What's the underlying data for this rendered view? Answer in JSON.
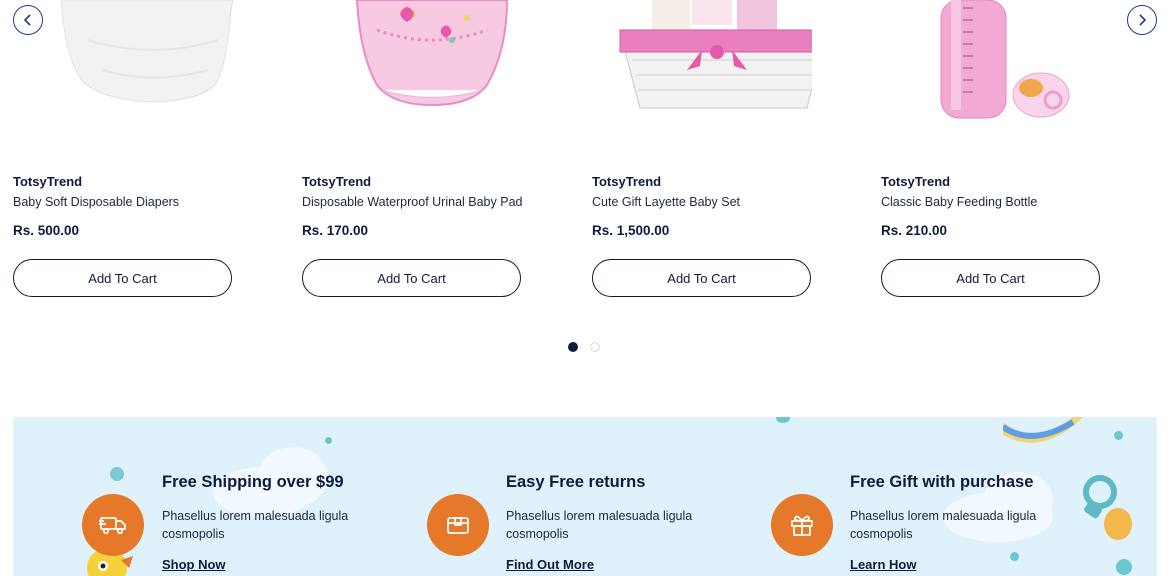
{
  "carousel": {
    "prev_icon": "chevron-left-icon",
    "next_icon": "chevron-right-icon",
    "products": [
      {
        "brand": "TotsyTrend",
        "title": "Baby Soft Disposable Diapers",
        "price": "Rs. 500.00",
        "cta": "Add To Cart",
        "image": "diaper-image"
      },
      {
        "brand": "TotsyTrend",
        "title": "Disposable Waterproof Urinal Baby Pad",
        "price": "Rs. 170.00",
        "cta": "Add To Cart",
        "image": "baby-pad-image"
      },
      {
        "brand": "TotsyTrend",
        "title": "Cute Gift Layette Baby Set",
        "price": "Rs. 1,500.00",
        "cta": "Add To Cart",
        "image": "gift-basket-image"
      },
      {
        "brand": "TotsyTrend",
        "title": "Classic Baby Feeding Bottle",
        "price": "Rs. 210.00",
        "cta": "Add To Cart",
        "image": "feeding-bottle-image"
      }
    ],
    "pagination": {
      "current": 1,
      "total": 2
    }
  },
  "features": [
    {
      "icon": "truck-icon",
      "heading": "Free Shipping over $99",
      "desc": "Phasellus lorem malesuada ligula cosmopolis",
      "link": "Shop Now"
    },
    {
      "icon": "box-icon",
      "heading": "Easy Free returns",
      "desc": "Phasellus lorem malesuada ligula cosmopolis",
      "link": "Find Out More"
    },
    {
      "icon": "gift-icon",
      "heading": "Free Gift with purchase",
      "desc": "Phasellus lorem malesuada ligula cosmopolis",
      "link": "Learn How"
    }
  ],
  "colors": {
    "navy": "#0f1b3d",
    "accent": "#e6782a",
    "banner_bg": "#dff1fb",
    "pink": "#e98bc4"
  }
}
